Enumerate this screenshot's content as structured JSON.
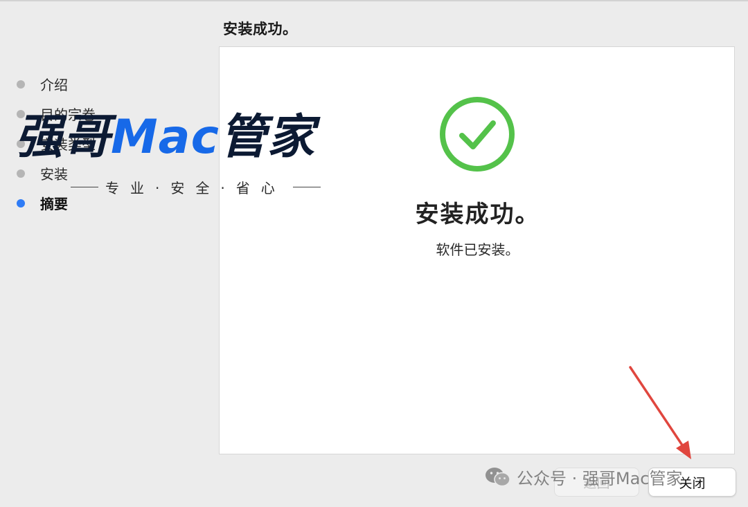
{
  "header": {
    "title": "安装成功。"
  },
  "sidebar": {
    "steps": [
      {
        "label": "介绍",
        "state": "done"
      },
      {
        "label": "目的宗卷",
        "state": "done"
      },
      {
        "label": "安装类型",
        "state": "done"
      },
      {
        "label": "安装",
        "state": "done"
      },
      {
        "label": "摘要",
        "state": "current"
      }
    ]
  },
  "main": {
    "success_title": "安装成功。",
    "success_subtitle": "软件已安装。",
    "icon": "checkmark-circle-icon"
  },
  "footer": {
    "back_label": "返回",
    "close_label": "关闭"
  },
  "overlay": {
    "brand_part1": "强哥",
    "brand_part2": "Mac",
    "brand_part3": "管家",
    "tagline": "专业·安全·省心",
    "credit_text": "公众号 · 强哥Mac管家"
  },
  "colors": {
    "accent": "#2f7cf6",
    "check_green": "#54c24a",
    "annotation_arrow": "#e0463e",
    "brand_blue": "#1769e8",
    "brand_dark": "#0c1a33"
  }
}
